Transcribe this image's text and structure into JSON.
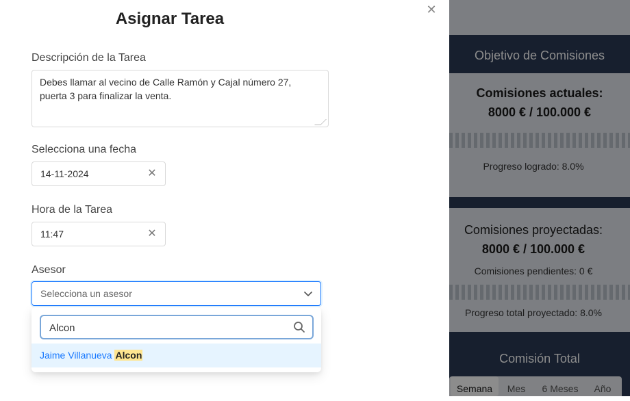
{
  "modal": {
    "title": "Asignar Tarea",
    "close_icon": "close-icon",
    "description_label": "Descripción de la Tarea",
    "description_value": "Debes llamar al vecino de Calle Ramón y Cajal número 27, puerta 3 para finalizar la venta.",
    "date_label": "Selecciona una fecha",
    "date_value": "14-11-2024",
    "time_label": "Hora de la Tarea",
    "time_value": "11:47",
    "advisor_label": "Asesor",
    "advisor_placeholder": "Selecciona un asesor",
    "search_value": "Alcon",
    "option_prefix": "Jaime Villanueva ",
    "option_match": "Alcon"
  },
  "dashboard": {
    "goal_title": "Objetivo de Comisiones",
    "current_label": "Comisiones actuales:",
    "current_value": "8000 € / 100.000 €",
    "progress_text": "Progreso logrado: 8.0%",
    "progress_fraction": 0.08,
    "projected_label": "Comisiones proyectadas:",
    "projected_value": "8000 € / 100.000 €",
    "pending_text": "Comisiones pendientes: 0 €",
    "projected_progress_text": "Progreso total proyectado: 8.0%",
    "total_title": "Comisión Total",
    "tabs": [
      "Semana",
      "Mes",
      "6 Meses",
      "Año"
    ],
    "active_tab": "Semana"
  },
  "colors": {
    "accent": "#1677ff",
    "header_band": "#2b3a55",
    "highlight": "#ffe58f"
  }
}
